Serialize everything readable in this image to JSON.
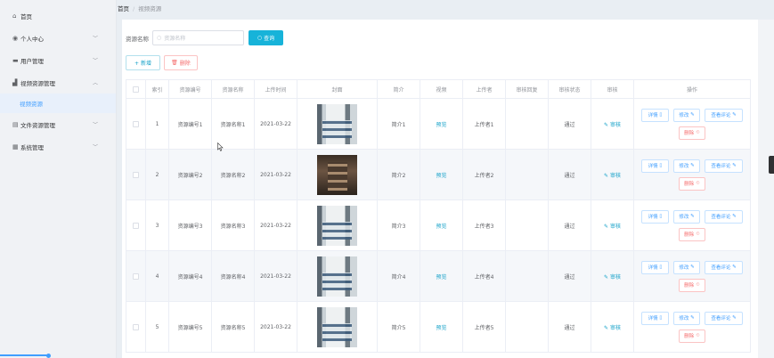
{
  "sidebar": {
    "items": [
      {
        "label": "首页",
        "icon": "home-icon",
        "glyph": "⌂",
        "has_arrow": false
      },
      {
        "label": "个人中心",
        "icon": "user-icon",
        "glyph": "◉",
        "has_arrow": true
      },
      {
        "label": "用户管理",
        "icon": "monitor-icon",
        "glyph": "▬",
        "has_arrow": true
      },
      {
        "label": "视频资源管理",
        "icon": "chart-icon",
        "glyph": "▟",
        "has_arrow": true,
        "expanded": true
      },
      {
        "label": "文件资源管理",
        "icon": "document-icon",
        "glyph": "▤",
        "has_arrow": true
      },
      {
        "label": "系统管理",
        "icon": "grid-icon",
        "glyph": "▦",
        "has_arrow": true
      }
    ],
    "sub_item": "视频资源",
    "accent": "#409eff"
  },
  "breadcrumb": {
    "home": "首页",
    "sep": "/",
    "current": "视频资源"
  },
  "search": {
    "label": "资源名称",
    "placeholder": "资源名称",
    "button": "查询"
  },
  "actions": {
    "add": "+ 新增",
    "delete": "删除"
  },
  "table": {
    "headers": [
      "",
      "索引",
      "资源编号",
      "资源名称",
      "上传时间",
      "封面",
      "简介",
      "视频",
      "上传者",
      "审核回复",
      "审核状态",
      "审核",
      "操作"
    ],
    "rows": [
      {
        "index": "1",
        "code": "资源编号1",
        "name": "资源名称1",
        "time": "2021-03-22",
        "cover": "light",
        "intro": "简介1",
        "video": "预览",
        "uploader": "上传者1",
        "reply": "",
        "status": "通过",
        "audit": "审核"
      },
      {
        "index": "2",
        "code": "资源编号2",
        "name": "资源名称2",
        "time": "2021-03-22",
        "cover": "dark",
        "intro": "简介2",
        "video": "预览",
        "uploader": "上传者2",
        "reply": "",
        "status": "通过",
        "audit": "审核"
      },
      {
        "index": "3",
        "code": "资源编号3",
        "name": "资源名称3",
        "time": "2021-03-22",
        "cover": "light",
        "intro": "简介3",
        "video": "预览",
        "uploader": "上传者3",
        "reply": "",
        "status": "通过",
        "audit": "审核"
      },
      {
        "index": "4",
        "code": "资源编号4",
        "name": "资源名称4",
        "time": "2021-03-22",
        "cover": "light",
        "intro": "简介4",
        "video": "预览",
        "uploader": "上传者4",
        "reply": "",
        "status": "通过",
        "audit": "审核"
      },
      {
        "index": "5",
        "code": "资源编号5",
        "name": "资源名称5",
        "time": "2021-03-22",
        "cover": "light",
        "intro": "简介5",
        "video": "预览",
        "uploader": "上传者5",
        "reply": "",
        "status": "通过",
        "audit": "审核"
      }
    ],
    "ops": {
      "detail": "详情",
      "edit": "修改",
      "comments": "查看评论",
      "delete": "删除"
    }
  },
  "colors": {
    "primary": "#17b3d9",
    "danger": "#f56c6c",
    "link": "#17a2c9"
  }
}
